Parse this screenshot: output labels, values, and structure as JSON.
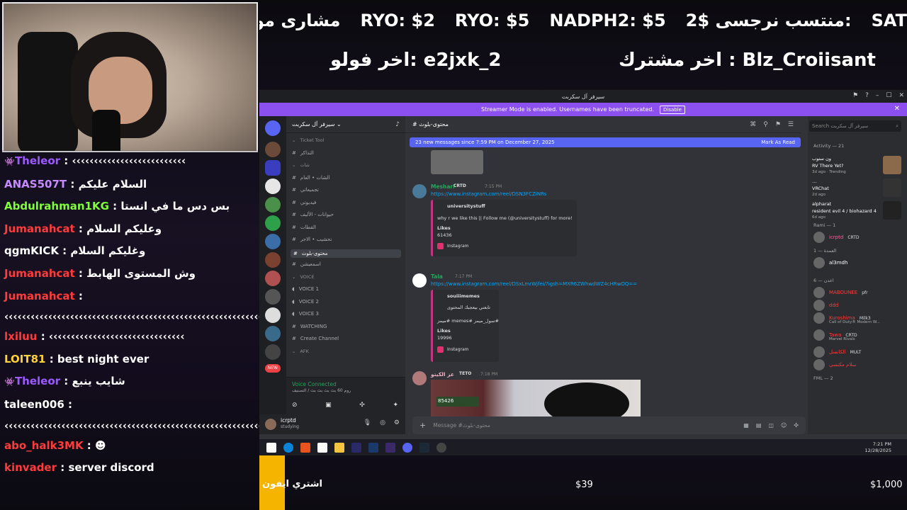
{
  "overlay": {
    "ticker": [
      "مشارى مو ما",
      "RYO: $2",
      "RYO: $5",
      "NADPH2: $5",
      "2$ منتسب نرجسى:",
      "SAT"
    ],
    "last_follower": "اخر فولو: e2jxk_2",
    "last_sub": "اخر مشترك : Blz_Croiisant"
  },
  "chat": [
    {
      "user": "Theleor",
      "color": "#9b59ff",
      "badge": "👾",
      "text": " : ‹‹‹‹‹‹‹‹‹‹‹‹‹‹‹‹‹‹‹‹‹‹‹‹‹‹"
    },
    {
      "user": "ANAS507T",
      "color": "#c48bff",
      "text": " : السلام عليكم"
    },
    {
      "user": "Abdulrahman1KG",
      "color": "#7fff3a",
      "text": " : بس دس ما في انستا"
    },
    {
      "user": "Jumanahcat",
      "color": "#ff3b3b",
      "text": " : وعليكم السلام"
    },
    {
      "user": "qgmKICK",
      "color": "#ffffff",
      "text": " : وغليكم السلام"
    },
    {
      "user": "Jumanahcat",
      "color": "#ff3b3b",
      "text": " : وش المستوى الهابط"
    },
    {
      "user": "Jumanahcat",
      "color": "#ff3b3b",
      "text": " :"
    },
    {
      "user": "",
      "color": "#ffffff",
      "text": "‹‹‹‹‹‹‹‹‹‹‹‹‹‹‹‹‹‹‹‹‹‹‹‹‹‹‹‹‹‹‹‹‹‹‹‹‹‹‹‹‹‹‹‹‹‹‹‹‹‹‹‹‹‹‹‹‹‹‹‹‹‹‹‹‹‹‹‹‹",
      "wrap": true
    },
    {
      "user": "lxiluu",
      "color": "#ff3b3b",
      "text": " : ‹‹‹‹‹‹‹‹‹‹‹‹‹‹‹‹‹‹‹‹‹‹‹‹‹‹‹‹‹‹‹"
    },
    {
      "user": "LOIT81",
      "color": "#ffd23a",
      "text": " : best night ever"
    },
    {
      "user": "Theleor",
      "color": "#9b59ff",
      "badge": "👾",
      "text": " : شايب ينبع"
    },
    {
      "user": "taleen006",
      "color": "#ffffff",
      "text": " :"
    },
    {
      "user": "",
      "color": "#ffffff",
      "text": "‹‹‹‹‹‹‹‹‹‹‹‹‹‹‹‹‹‹‹‹‹‹‹‹‹‹‹‹‹‹‹‹‹‹‹‹‹‹‹‹‹‹‹‹‹‹‹‹‹‹‹‹‹‹‹‹‹‹‹‹‹‹‹‹‹‹‹‹‹",
      "wrap": true
    },
    {
      "user": "abo_halk3MK",
      "color": "#ff3b3b",
      "text": " : ☻"
    },
    {
      "user": "kinvader",
      "color": "#ff3b3b",
      "text": " : server discord"
    }
  ],
  "goal": {
    "name": "اشتري ايفون",
    "current": "$39",
    "max": "$1,000",
    "fraction": 0.039
  },
  "discord": {
    "window_title": "سيرفر آل سكربت",
    "banner": "Streamer Mode is enabled. Usernames have been truncated.",
    "banner_btn": "Disable",
    "server_name": "سيرفر آل سكربت",
    "channels": [
      {
        "name": "Ticket Tool",
        "type": "cat"
      },
      {
        "name": "التذاكر",
        "type": "ch"
      },
      {
        "name": "شات",
        "type": "cat"
      },
      {
        "name": "الشات • العام",
        "type": "ch"
      },
      {
        "name": "تجميعاتي",
        "type": "ch"
      },
      {
        "name": "فيديوتي",
        "type": "ch"
      },
      {
        "name": "حيوانات - الأليف",
        "type": "ch"
      },
      {
        "name": "القطات",
        "type": "ch"
      },
      {
        "name": "تحشيب • الاجر",
        "type": "ch"
      },
      {
        "name": "محتوى-بلوث",
        "type": "active"
      },
      {
        "name": "اسمعيشن",
        "type": "ch"
      },
      {
        "name": "VOICE",
        "type": "cat"
      },
      {
        "name": "VOICE 1",
        "type": "ch"
      },
      {
        "name": "VOICE 2",
        "type": "ch"
      },
      {
        "name": "VOICE 3",
        "type": "ch"
      },
      {
        "name": "WATCHING",
        "type": "ch"
      },
      {
        "name": "Create Channel",
        "type": "ch"
      },
      {
        "name": "AFK",
        "type": "cat"
      }
    ],
    "voice_connected": "Voice Connected",
    "voice_sub": "روم 60 بث بث بث بث / التصنيف",
    "user_name": "icrptd",
    "user_status": "studying",
    "channel_header": "محتوى-بلوث",
    "new_messages": "23 new messages since 7:59 PM on December 27, 2025",
    "mark_read": "Mark As Read",
    "posts": [
      {
        "user": "Meshari",
        "tag": "CRTD",
        "time": "7:15 PM",
        "link": "https://www.instagram.com/reel/DSN3FCZiNRs",
        "embed_author": "universitystuff",
        "embed_text": "why r we like this || Follow me (@universitystuff) for more!",
        "likes_label": "Likes",
        "likes": "61436",
        "source": "Instagram"
      },
      {
        "user": "Tala",
        "tag": "",
        "time": "7:17 PM",
        "link": "https://www.instagram.com/reel/DSxLmrWjfei/?igsh=MXR6ZWhwdWZ4cHRwOQ==",
        "embed_author": "souiiimemes",
        "embed_text": "تابعني بيعجبك المحتوى",
        "embed_text2": "ميمز# memes# سول_ميمز#",
        "likes_label": "Likes",
        "likes": "19996",
        "source": "Instagram"
      },
      {
        "user": "عز الكيتو",
        "tag": "TETO",
        "time": "7:18 PM",
        "video_label": "85426"
      }
    ],
    "compose_placeholder": "Message #محتوى-بلوث",
    "search_placeholder": "Search سيرفر آل سكربت",
    "activity_title": "Activity — 21",
    "activities": [
      {
        "name": "ون ستوب",
        "game": "RV There Yet?",
        "detail": "3d ago · Trending"
      },
      {
        "name": "…",
        "game": "VRChat",
        "detail": "2d ago"
      },
      {
        "name": "alpharat",
        "game": "resident evil 4 / biohazard 4",
        "detail": "6d ago"
      }
    ],
    "groups": [
      {
        "title": "Rami — 1",
        "members": [
          {
            "name": "icrptd",
            "tag": "CRTD",
            "color": "#ff5fa2"
          }
        ]
      },
      {
        "title": "العمدة — 1",
        "members": [
          {
            "name": "al3mdh",
            "tag": "",
            "color": "#ffffff"
          }
        ]
      },
      {
        "title": "اعدن — 6",
        "members": [
          {
            "name": "MABOUNEE",
            "tag": "pfr",
            "color": "#ff3b3b"
          },
          {
            "name": "ddd",
            "tag": "",
            "color": "#ff3b3b"
          },
          {
            "name": "Kuroshima",
            "tag": "Milk3",
            "color": "#ff3b3b",
            "sub": "Call of Duty® Modern W..."
          },
          {
            "name": "Tawa",
            "tag": "CRTD",
            "color": "#ff3b3b",
            "sub": "Marvel Rivals"
          },
          {
            "name": "الكانسل",
            "tag": "MULT",
            "color": "#ff3b3b"
          },
          {
            "name": "سلام مكنسي",
            "tag": "",
            "color": "#ff3b3b"
          }
        ]
      },
      {
        "title": "FML — 2",
        "members": []
      }
    ]
  },
  "taskbar": {
    "time": "7:21 PM",
    "date": "12/28/2025"
  }
}
